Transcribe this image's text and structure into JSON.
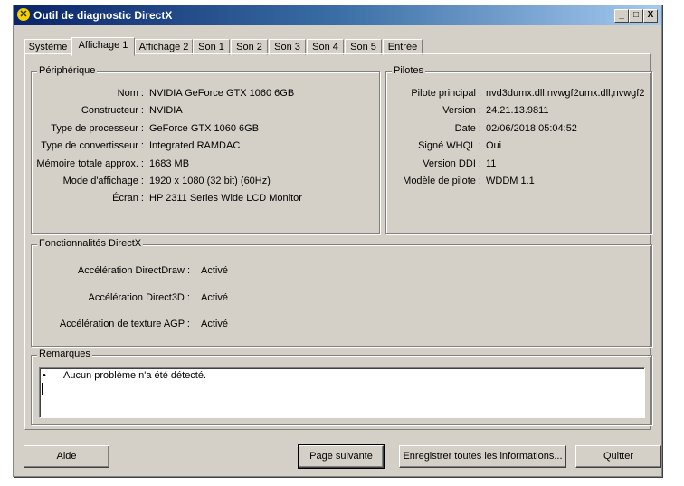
{
  "window": {
    "title": "Outil de diagnostic DirectX",
    "minimize": "_",
    "maximize": "□",
    "close": "X"
  },
  "tabs": [
    "Système",
    "Affichage 1",
    "Affichage 2",
    "Son 1",
    "Son 2",
    "Son 3",
    "Son 4",
    "Son 5",
    "Entrée"
  ],
  "active_tab": "Affichage 1",
  "device": {
    "title": "Périphérique",
    "rows": [
      {
        "label": "Nom :",
        "value": "NVIDIA GeForce GTX 1060 6GB"
      },
      {
        "label": "Constructeur :",
        "value": "NVIDIA"
      },
      {
        "label": "Type de processeur :",
        "value": "GeForce GTX 1060 6GB"
      },
      {
        "label": "Type de convertisseur :",
        "value": "Integrated RAMDAC"
      },
      {
        "label": "Mémoire totale approx. :",
        "value": "1683 MB"
      },
      {
        "label": "Mode d'affichage :",
        "value": "1920 x 1080 (32 bit) (60Hz)"
      },
      {
        "label": "Écran :",
        "value": "HP 2311 Series Wide LCD Monitor"
      }
    ]
  },
  "drivers": {
    "title": "Pilotes",
    "rows": [
      {
        "label": "Pilote principal :",
        "value": "nvd3dumx.dll,nvwgf2umx.dll,nvwgf2"
      },
      {
        "label": "Version :",
        "value": "24.21.13.9811"
      },
      {
        "label": "Date :",
        "value": "02/06/2018 05:04:52"
      },
      {
        "label": "Signé WHQL :",
        "value": "Oui"
      },
      {
        "label": "Version DDI :",
        "value": "11"
      },
      {
        "label": "Modèle de pilote :",
        "value": "WDDM 1.1"
      }
    ]
  },
  "features": {
    "title": "Fonctionnalités DirectX",
    "rows": [
      {
        "label": "Accélération DirectDraw :",
        "value": "Activé"
      },
      {
        "label": "Accélération Direct3D :",
        "value": "Activé"
      },
      {
        "label": "Accélération de texture AGP :",
        "value": "Activé"
      }
    ]
  },
  "notes": {
    "title": "Remarques",
    "bullet": "•",
    "text": "Aucun problème n'a été détecté."
  },
  "buttons": {
    "help": "Aide",
    "next": "Page suivante",
    "save": "Enregistrer toutes les informations...",
    "quit": "Quitter"
  }
}
